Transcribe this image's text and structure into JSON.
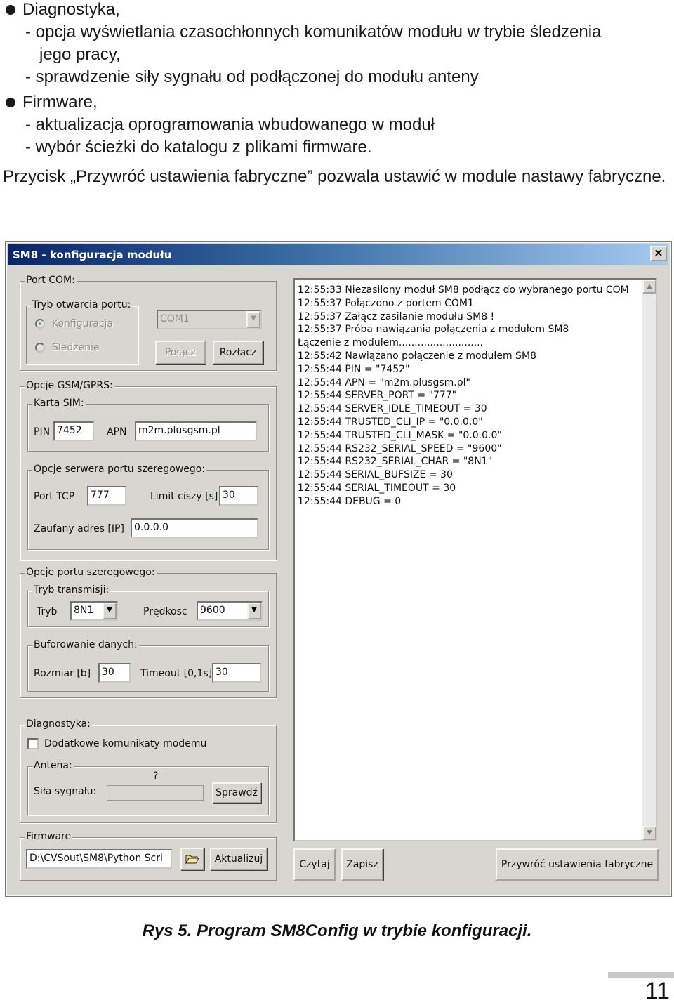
{
  "doc": {
    "bullets": [
      {
        "title": "Diagnostyka,",
        "items": [
          "- opcja wyświetlania czasochłonnych komunikatów modułu w trybie śledzenia",
          "jego pracy,",
          "- sprawdzenie siły sygnału od podłączonej do modułu anteny"
        ]
      },
      {
        "title": "Firmware,",
        "items": [
          "- aktualizacja oprogramowania wbudowanego w moduł",
          "- wybór ścieżki do katalogu z plikami firmware."
        ]
      }
    ],
    "paragraph": "Przycisk „Przywróć ustawienia fabryczne” pozwala ustawić w module nastawy fabryczne.",
    "caption": "Rys 5. Program SM8Config w trybie konfiguracji.",
    "page_number": "11"
  },
  "window": {
    "title": "SM8 - konfiguracja modułu",
    "close_label": "×",
    "port_com": {
      "title": "Port COM:",
      "mode_title": "Tryb otwarcia portu:",
      "radio_config": "Konfiguracja",
      "radio_trace": "Śledzenie",
      "selected_mode": "Konfiguracja",
      "port_value": "COM1",
      "connect_label": "Połącz",
      "disconnect_label": "Rozłącz"
    },
    "gsm": {
      "title": "Opcje GSM/GPRS:",
      "sim_title": "Karta SIM:",
      "pin_label": "PIN",
      "pin_value": "7452",
      "apn_label": "APN",
      "apn_value": "m2m.plusgsm.pl",
      "server_title": "Opcje serwera portu szeregowego:",
      "tcp_label": "Port TCP",
      "tcp_value": "777",
      "silence_label": "Limit ciszy [s]",
      "silence_value": "30",
      "trusted_label": "Zaufany adres [IP]",
      "trusted_value": "0.0.0.0"
    },
    "serial": {
      "title": "Opcje portu szeregowego:",
      "mode_title": "Tryb transmisji:",
      "mode_label": "Tryb",
      "mode_value": "8N1",
      "speed_label": "Prędkosc",
      "speed_value": "9600",
      "buffer_title": "Buforowanie danych:",
      "size_label": "Rozmiar [b]",
      "size_value": "30",
      "timeout_label": "Timeout [0,1s]",
      "timeout_value": "30"
    },
    "diag": {
      "title": "Diagnostyka:",
      "checkbox_label": "Dodatkowe komunikaty modemu",
      "checkbox_checked": false,
      "antenna_title": "Antena:",
      "signal_unknown": "?",
      "signal_label": "Siła sygnału:",
      "check_label": "Sprawdź"
    },
    "firmware": {
      "title": "Firmware",
      "path_value": "D:\\CVSout\\SM8\\Python Scri",
      "folder_icon": "folder-open-icon",
      "update_label": "Aktualizuj"
    },
    "log": [
      "12:55:33  Niezasilony moduł SM8 podłącz do wybranego portu COM",
      "12:55:37  Połączono z portem COM1",
      "12:55:37  Załącz zasilanie modułu SM8 !",
      "12:55:37  Próba nawiązania połączenia z modułem SM8",
      " Łączenie z modułem...........................",
      "12:55:42  Nawiązano połączenie z modułem SM8",
      "12:55:44  PIN = \"7452\"",
      "12:55:44  APN = \"m2m.plusgsm.pl\"",
      "12:55:44  SERVER_PORT = \"777\"",
      "12:55:44  SERVER_IDLE_TIMEOUT = 30",
      "12:55:44  TRUSTED_CLI_IP = \"0.0.0.0\"",
      "12:55:44  TRUSTED_CLI_MASK = \"0.0.0.0\"",
      "12:55:44  RS232_SERIAL_SPEED = \"9600\"",
      "12:55:44  RS232_SERIAL_CHAR = \"8N1\"",
      "12:55:44  SERIAL_BUFSIZE = 30",
      "12:55:44  SERIAL_TIMEOUT = 30",
      "12:55:44  DEBUG = 0"
    ],
    "buttons": {
      "read": "Czytaj",
      "write": "Zapisz",
      "restore": "Przywróć ustawienia fabryczne"
    }
  }
}
